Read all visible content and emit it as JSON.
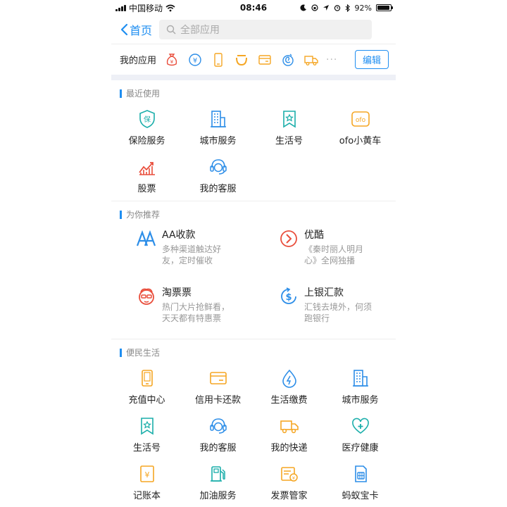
{
  "status_bar": {
    "carrier": "中国移动",
    "time": "08:46",
    "battery": "92%",
    "battery_level": 0.92
  },
  "nav": {
    "back_label": "首页",
    "search_placeholder": "全部应用"
  },
  "my_apps": {
    "label": "我的应用",
    "icons": [
      "money-bag-icon",
      "yuan-exchange-icon",
      "phone-icon",
      "didi-icon",
      "card-icon",
      "spiral-icon",
      "truck-icon"
    ],
    "more": "···",
    "edit_label": "编辑"
  },
  "recent": {
    "title": "最近使用",
    "items": [
      {
        "label": "保险服务",
        "icon": "shield-icon"
      },
      {
        "label": "城市服务",
        "icon": "building-icon"
      },
      {
        "label": "生活号",
        "icon": "star-badge-icon"
      },
      {
        "label": "ofo小黄车",
        "icon": "ofo-icon"
      },
      {
        "label": "股票",
        "icon": "stock-chart-icon"
      },
      {
        "label": "我的客服",
        "icon": "headset-icon"
      }
    ]
  },
  "recommend": {
    "title": "为你推荐",
    "items": [
      {
        "title": "AA收款",
        "desc": "多种渠道触达好友，定时催收",
        "icon": "aa-icon"
      },
      {
        "title": "优酷",
        "desc": "《秦时丽人明月心》全网独播",
        "icon": "youku-icon"
      },
      {
        "title": "淘票票",
        "desc": "热门大片抢鲜看，天天都有特惠票",
        "icon": "taopiaopiao-icon"
      },
      {
        "title": "上银汇款",
        "desc": "汇钱去境外，何须跑银行",
        "icon": "dollar-icon"
      }
    ]
  },
  "life": {
    "title": "便民生活",
    "items": [
      {
        "label": "充值中心",
        "icon": "phone-icon"
      },
      {
        "label": "信用卡还款",
        "icon": "card-icon"
      },
      {
        "label": "生活缴费",
        "icon": "water-drop-icon"
      },
      {
        "label": "城市服务",
        "icon": "building-icon"
      },
      {
        "label": "生活号",
        "icon": "star-badge-icon"
      },
      {
        "label": "我的客服",
        "icon": "headset-icon"
      },
      {
        "label": "我的快递",
        "icon": "truck-icon"
      },
      {
        "label": "医疗健康",
        "icon": "medical-heart-icon"
      },
      {
        "label": "记账本",
        "icon": "ledger-icon"
      },
      {
        "label": "加油服务",
        "icon": "fuel-icon"
      },
      {
        "label": "发票管家",
        "icon": "invoice-icon"
      },
      {
        "label": "蚂蚁宝卡",
        "icon": "sim-card-icon"
      }
    ]
  },
  "colors": {
    "accent": "#1f8ef1",
    "orange": "#f5a623",
    "red": "#e94e3c",
    "teal": "#1aaeaa",
    "blue": "#2d8ee8"
  }
}
